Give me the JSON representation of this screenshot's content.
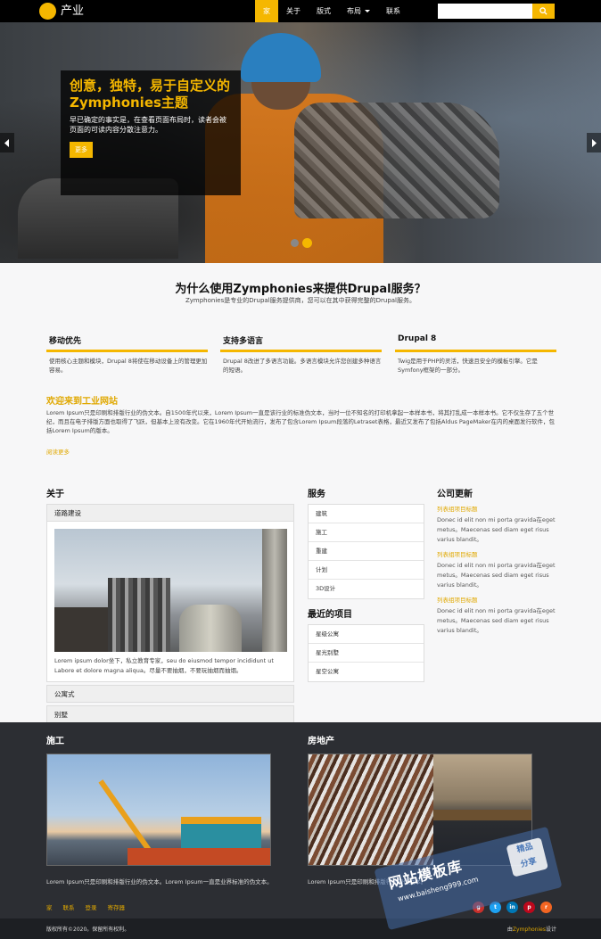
{
  "header": {
    "site_name": "产业",
    "nav": [
      "家",
      "关于",
      "版式",
      "布局",
      "联系"
    ],
    "search_placeholder": ""
  },
  "hero": {
    "title": "创意，独特，易于自定义的Zymphonies主题",
    "text": "早已确定的事实是，在查看页面布局时，读者会被页面的可读内容分散注意力。",
    "button": "更多"
  },
  "why": {
    "title": "为什么使用Zymphonies来提供Drupal服务？",
    "subtitle": "Zymphonies是专业的Drupal服务提供商，您可以在其中获得完整的Drupal服务。",
    "features": [
      {
        "title": "移动优先",
        "text": "使用核心主题和模块，Drupal 8将使在移动设备上的管理更加容易。"
      },
      {
        "title": "支持多语言",
        "text": "Drupal 8改进了多语言功能。多语言模块允许您创建多种语言的短语。"
      },
      {
        "title": "Drupal 8",
        "text": "Twig是用于PHP的灵活，快速且安全的模板引擎。它是Symfony框架的一部分。"
      }
    ]
  },
  "welcome": {
    "title": "欢迎来到工业网站",
    "text": "Lorem Ipsum只是印刷和排版行业的伪文本。自1500年代以来，Lorem Ipsum一直是该行业的标准伪文本，当时一位不知名的打印机拿起一本样本书，将其打乱成一本样本书。它不仅生存了五个世纪，而且在电子排版方面也取得了飞跃，但基本上没有改变。它在1960年代开始流行，发布了包含Lorem Ipsum段落的Letraset表格，最近又发布了包括Aldus PageMaker在内的桌面发行软件，包括Lorem Ipsum的版本。",
    "read_more": "阅读更多"
  },
  "about": {
    "title": "关于",
    "items": [
      "道路建设",
      "公寓式",
      "别墅"
    ],
    "body_text": "Lorem ipsum dolor坐下，私立教育专家，seu do eiusmod tempor incididunt ut Labore et dolore magna aliqua。尽量不要抽烟，不要玩抽烟而抽烟。"
  },
  "services": {
    "title": "服务",
    "items": [
      "建筑",
      "施工",
      "重建",
      "计划",
      "3D设计"
    ],
    "projects_title": "最近的项目",
    "projects": [
      "星级公寓",
      "星光别墅",
      "星空公寓"
    ]
  },
  "news": {
    "title": "公司更新",
    "items": [
      {
        "title": "列表组项目标题",
        "text": "Donec id elit non mi porta gravida在eget metus。Maecenas sed diam eget risus varius blandit。"
      },
      {
        "title": "列表组项目标题",
        "text": "Donec id elit non mi porta gravida在eget metus。Maecenas sed diam eget risus varius blandit。"
      },
      {
        "title": "列表组项目标题",
        "text": "Donec id elit non mi porta gravida在eget metus。Maecenas sed diam eget risus varius blandit。"
      }
    ]
  },
  "dark": {
    "col1": {
      "title": "施工",
      "text": "Lorem Ipsum只是印刷和排版行业的伪文本。Lorem Ipsum一直是业界标准的伪文本。"
    },
    "col2": {
      "title": "房地产",
      "text": "Lorem Ipsum只是印刷和排版行业的伪文本。"
    }
  },
  "footer": {
    "links": [
      "家",
      "联系",
      "登录",
      "寄存器"
    ],
    "copyright": "版权所有©2020。保留所有权利。",
    "designed_prefix": "由",
    "designed_brand": "Zymphonies",
    "designed_suffix": "设计"
  },
  "watermark": {
    "main": "网站模板库",
    "url": "www.baisheng999.com",
    "tag1": "精品",
    "tag2": "分享"
  },
  "colors": {
    "accent": "#f5b700",
    "dark": "#2c2e33"
  }
}
